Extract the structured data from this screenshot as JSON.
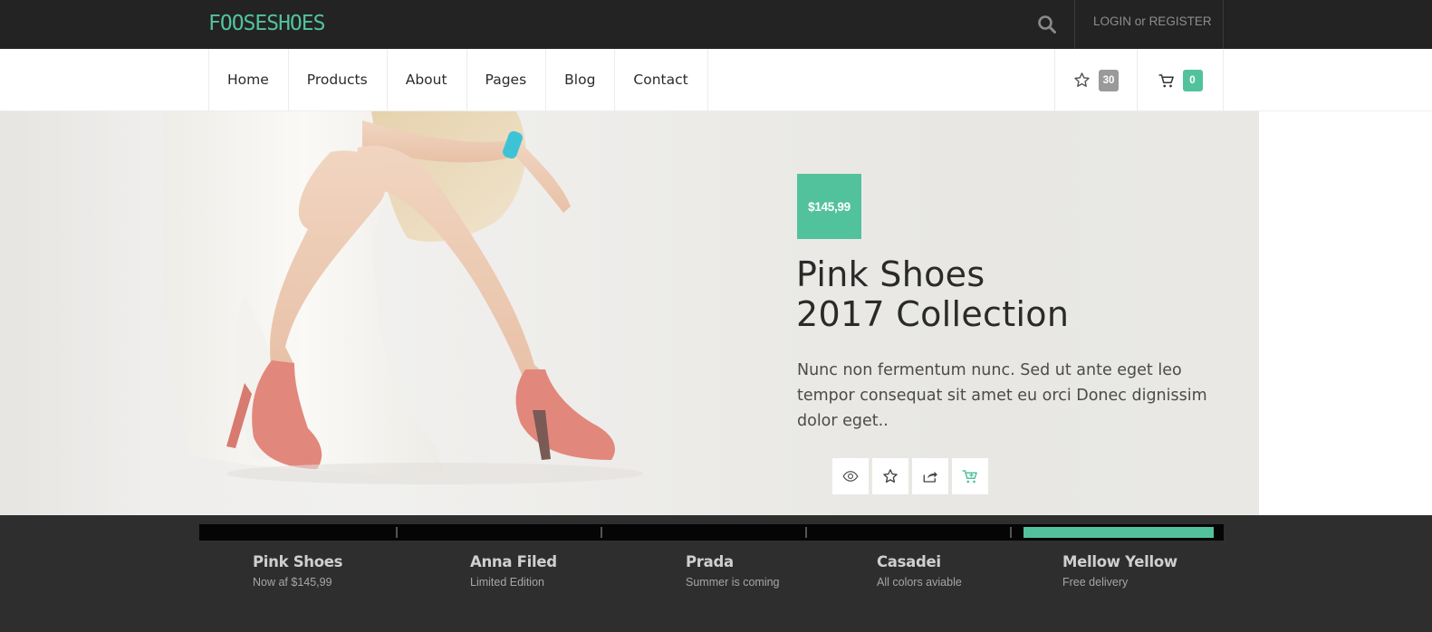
{
  "brand": {
    "logo": "FOOSESHOES",
    "accent": "#52c29d"
  },
  "topbar": {
    "search_icon": "search-icon",
    "login": "LOGIN",
    "separator": "or",
    "register": "REGISTER"
  },
  "nav": {
    "items": [
      {
        "label": "Home"
      },
      {
        "label": "Products"
      },
      {
        "label": "About"
      },
      {
        "label": "Pages"
      },
      {
        "label": "Blog"
      },
      {
        "label": "Contact"
      }
    ],
    "wishlist": {
      "icon": "star-icon",
      "count": "30"
    },
    "cart": {
      "icon": "cart-icon",
      "count": "0"
    }
  },
  "hero": {
    "price": "$145,99",
    "title_line1": "Pink Shoes",
    "title_line2": "2017 Collection",
    "description": "Nunc non fermentum nunc. Sed ut ante eget leo tempor consequat sit amet eu orci Donec dignissim dolor eget..",
    "actions": [
      {
        "icon": "eye-icon"
      },
      {
        "icon": "star-icon"
      },
      {
        "icon": "share-icon"
      },
      {
        "icon": "add-to-cart-icon"
      }
    ]
  },
  "slider": {
    "active_index": 4,
    "active_progress": 0.97,
    "items": [
      {
        "title": "Pink Shoes",
        "subtitle": "Now af $145,99"
      },
      {
        "title": "Anna Filed",
        "subtitle": "Limited Edition"
      },
      {
        "title": "Prada",
        "subtitle": "Summer is coming"
      },
      {
        "title": "Casadei",
        "subtitle": "All colors aviable"
      },
      {
        "title": "Mellow Yellow",
        "subtitle": "Free delivery"
      }
    ]
  }
}
